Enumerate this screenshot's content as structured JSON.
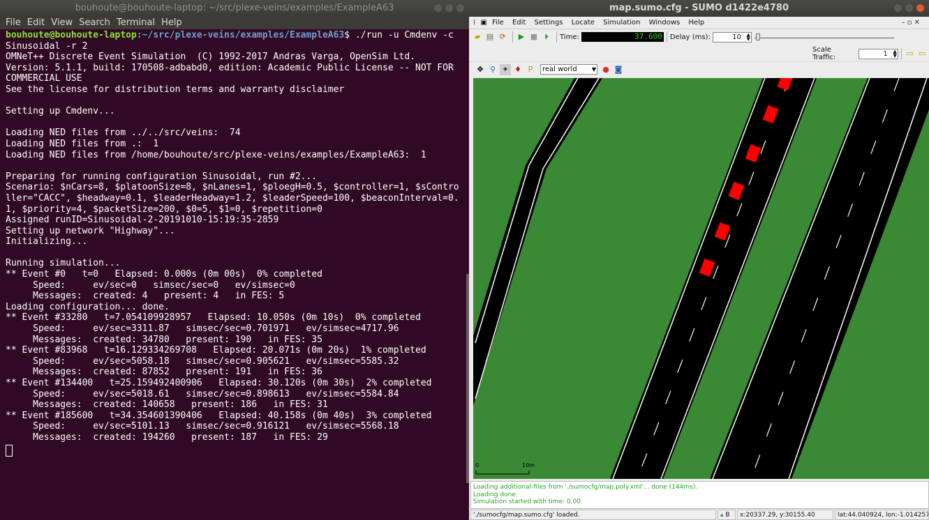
{
  "terminal": {
    "title": "bouhoute@bouhoute-laptop: ~/src/plexe-veins/examples/ExampleA63",
    "menu": [
      "File",
      "Edit",
      "View",
      "Search",
      "Terminal",
      "Help"
    ],
    "prompt_user": "bouhoute@bouhoute-laptop",
    "prompt_path": ":~/src/plexe-veins/examples/ExampleA63",
    "command": "$ ./run -u Cmdenv -c",
    "lines": [
      "Sinusoidal -r 2",
      "OMNeT++ Discrete Event Simulation  (C) 1992-2017 Andras Varga, OpenSim Ltd.",
      "Version: 5.1.1, build: 170508-adbabd0, edition: Academic Public License -- NOT FOR",
      "COMMERCIAL USE",
      "See the license for distribution terms and warranty disclaimer",
      "",
      "Setting up Cmdenv...",
      "",
      "Loading NED files from ../../src/veins:  74",
      "Loading NED files from .:  1",
      "Loading NED files from /home/bouhoute/src/plexe-veins/examples/ExampleA63:  1",
      "",
      "Preparing for running configuration Sinusoidal, run #2...",
      "Scenario: $nCars=8, $platoonSize=8, $nLanes=1, $ploegH=0.5, $controller=1, $sContro",
      "ller=\"CACC\", $headway=0.1, $leaderHeadway=1.2, $leaderSpeed=100, $beaconInterval=0.",
      "1, $priority=4, $packetSize=200, $0=5, $1=0, $repetition=0",
      "Assigned runID=Sinusoidal-2-20191010-15:19:35-2859",
      "Setting up network \"Highway\"...",
      "Initializing...",
      "",
      "Running simulation...",
      "** Event #0   t=0   Elapsed: 0.000s (0m 00s)  0% completed",
      "     Speed:     ev/sec=0   simsec/sec=0   ev/simsec=0",
      "     Messages:  created: 4   present: 4   in FES: 5",
      "Loading configuration... done.",
      "** Event #33280   t=7.054109928957   Elapsed: 10.050s (0m 10s)  0% completed",
      "     Speed:     ev/sec=3311.87   simsec/sec=0.701971   ev/simsec=4717.96",
      "     Messages:  created: 34780   present: 190   in FES: 35",
      "** Event #83968   t=16.129334269708   Elapsed: 20.071s (0m 20s)  1% completed",
      "     Speed:     ev/sec=5058.18   simsec/sec=0.905621   ev/simsec=5585.32",
      "     Messages:  created: 87852   present: 191   in FES: 36",
      "** Event #134400   t=25.159492400906   Elapsed: 30.120s (0m 30s)  2% completed",
      "     Speed:     ev/sec=5018.61   simsec/sec=0.898613   ev/simsec=5584.84",
      "     Messages:  created: 140658   present: 186   in FES: 31",
      "** Event #185600   t=34.354601390406   Elapsed: 40.158s (0m 40s)  3% completed",
      "     Speed:     ev/sec=5101.13   simsec/sec=0.916121   ev/simsec=5568.18",
      "     Messages:  created: 194260   present: 187   in FES: 29"
    ]
  },
  "sumo": {
    "title": "map.sumo.cfg - SUMO d1422e4780",
    "menu": [
      "File",
      "Edit",
      "Settings",
      "Locate",
      "Simulation",
      "Windows",
      "Help"
    ],
    "time_label": "Time:",
    "time_value": "37.600",
    "delay_label": "Delay (ms):",
    "delay_value": "10",
    "scale_traffic_label": "Scale Traffic:",
    "scale_traffic_value": "1",
    "color_scheme": "real world",
    "scale_bar": {
      "start": "0",
      "end": "10m"
    },
    "messages": [
      "Loading additional-files from './sumocfg/map.poly.xml'... done (144ms).",
      "Loading done.",
      "Simulation started with time: 0.00"
    ],
    "status": {
      "loaded": "'./sumocfg/map.sumo.cfg' loaded.",
      "indicator": "B",
      "coords": "x:20337.29, y:30155.40",
      "latlon": "lat:44.040924, lon:-1.014257"
    },
    "colors": {
      "grass": "#3a8a35",
      "road": "#000000",
      "vehicle": "#ff0000",
      "lane_mark": "#ffffff"
    }
  }
}
